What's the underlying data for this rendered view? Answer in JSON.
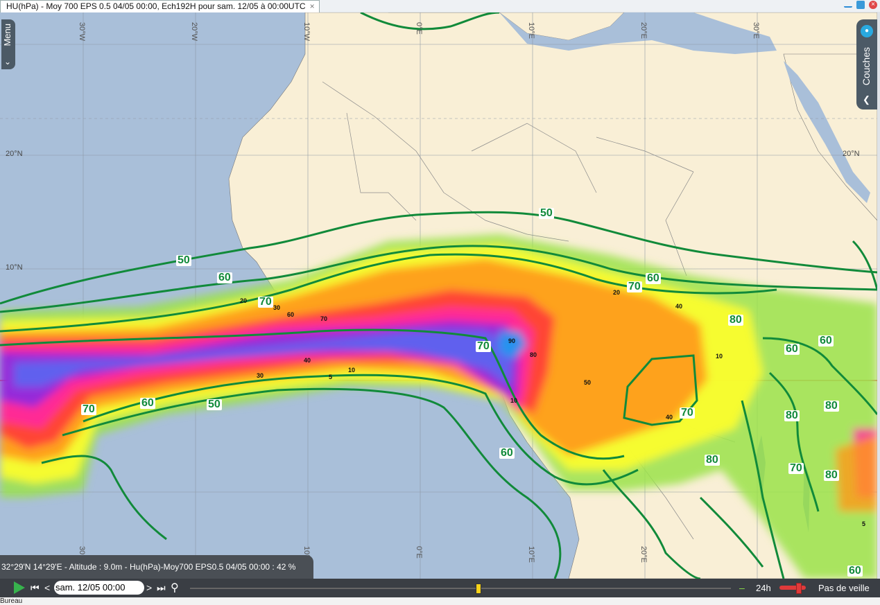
{
  "window": {
    "tab_title": "HU(hPa) - Moy 700 EPS 0.5 04/05 00:00, Ech192H pour sam. 12/05 à 00:00UTC",
    "tab_close": "×"
  },
  "menu": {
    "label": "Menu"
  },
  "layers": {
    "label": "Couches"
  },
  "map": {
    "colors": {
      "ocean": "#a9bfd9",
      "land": "#f9efd6",
      "contour": "#118a3a",
      "equator": "#d01010"
    },
    "lat_labels": [
      "20°N",
      "10°N",
      "20°N"
    ],
    "lon_labels": [
      "30°W",
      "20°W",
      "10°W",
      "0°E",
      "10°E",
      "30°E",
      "20°E",
      "10°W",
      "0°E",
      "10°E",
      "20°E",
      "30°E"
    ],
    "contour_labels": [
      "50",
      "60",
      "70",
      "70",
      "60",
      "50",
      "70",
      "60",
      "50",
      "60",
      "70",
      "60",
      "80",
      "60",
      "70",
      "80",
      "80",
      "70",
      "80",
      "80",
      "60"
    ],
    "humidity_labels": [
      "20",
      "30",
      "60",
      "70",
      "40",
      "30",
      "10",
      "5",
      "90",
      "80",
      "10",
      "20",
      "40",
      "10",
      "50",
      "40",
      "5"
    ]
  },
  "status": {
    "text": "32°29'N 14°29'E - Altitude : 9.0m -  Hu(hPa)-Moy700 EPS0.5 04/05 00:00 : 42 %"
  },
  "player": {
    "date": "sam. 12/05 00:00",
    "step": "24h",
    "mode": "Pas de veille"
  },
  "footer": {
    "label": "Bureau"
  }
}
